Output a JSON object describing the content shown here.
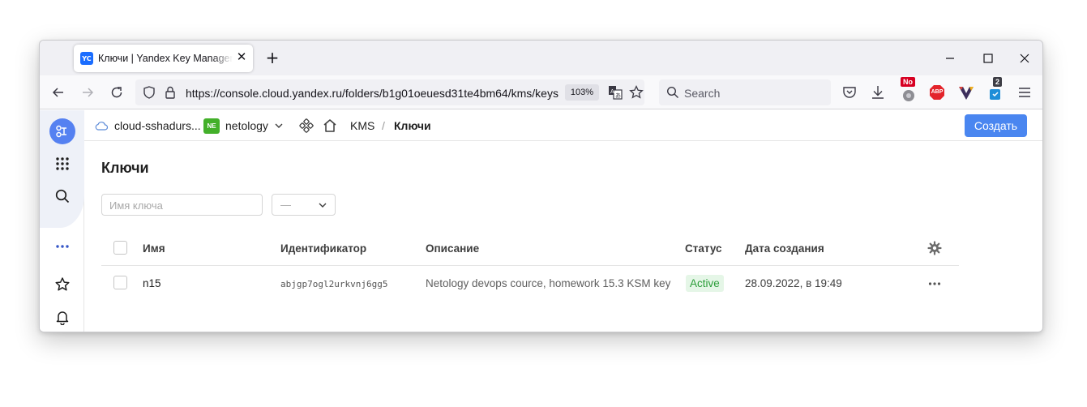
{
  "browser": {
    "tab": {
      "favicon_text": "YC",
      "title": "Ключи | Yandex Key Management Service"
    },
    "url": "https://console.cloud.yandex.ru/folders/b1g01oeuesd31te4bm64/kms/keys",
    "zoom": "103%",
    "search_placeholder": "Search",
    "extensions": {
      "no_badge": "No",
      "abp_label": "ABP",
      "notify_count": "2"
    }
  },
  "breadcrumbs": {
    "cloud": "cloud-sshadurs...",
    "folder_badge": "NE",
    "folder": "netology",
    "service": "KMS",
    "separator": "/",
    "page": "Ключи"
  },
  "header": {
    "create_button": "Создать"
  },
  "page": {
    "title": "Ключи",
    "filter": {
      "name_placeholder": "Имя ключа",
      "status_value": "—"
    }
  },
  "table": {
    "columns": [
      "Имя",
      "Идентификатор",
      "Описание",
      "Статус",
      "Дата создания"
    ],
    "rows": [
      {
        "name": "n15",
        "id": "abjgp7ogl2urkvnj6gg5",
        "description": "Netology devops cource, homework 15.3 KSM key",
        "status": "Active",
        "created": "28.09.2022, в 19:49"
      }
    ]
  },
  "colors": {
    "accent": "#4a86f0",
    "folder_badge": "#43b02a",
    "status_active": "#2a9d38",
    "favicon": "#1a6dff"
  },
  "icons": [
    "cloud-icon",
    "chevron-down-icon",
    "services-icon",
    "home-icon",
    "settings-gear-icon",
    "more-icon",
    "apps-grid-icon",
    "search-icon",
    "star-icon",
    "bell-icon"
  ]
}
